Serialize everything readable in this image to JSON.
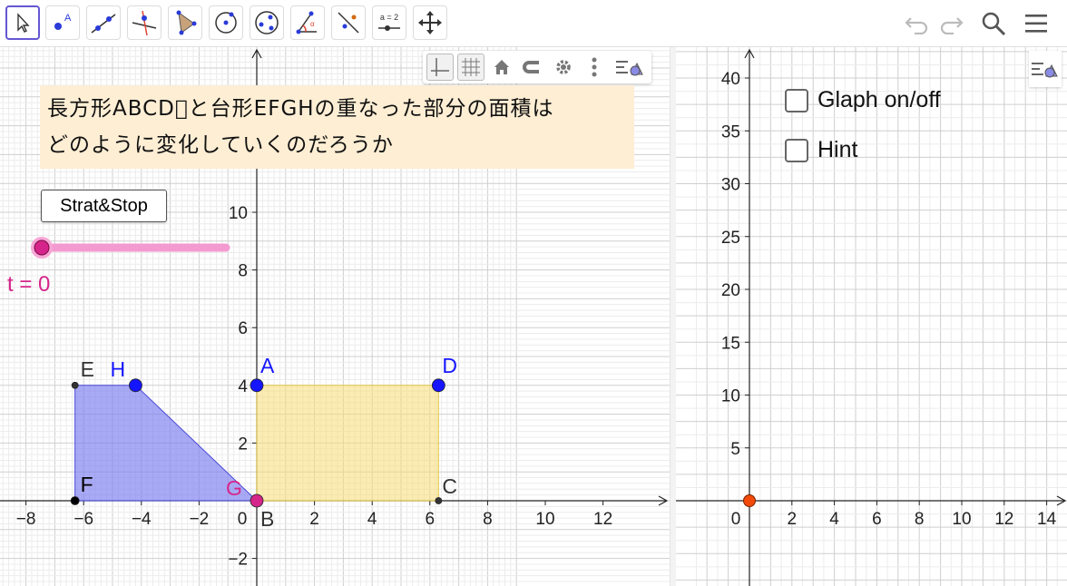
{
  "toolbar": {
    "tools": [
      {
        "name": "move-tool-icon",
        "selected": true
      },
      {
        "name": "point-tool-icon"
      },
      {
        "name": "line-tool-icon"
      },
      {
        "name": "perpendicular-line-tool-icon"
      },
      {
        "name": "polygon-tool-icon"
      },
      {
        "name": "circle-tool-icon"
      },
      {
        "name": "ellipse-tool-icon"
      },
      {
        "name": "angle-tool-icon"
      },
      {
        "name": "reflect-tool-icon"
      },
      {
        "name": "slider-tool-icon",
        "label": "a = 2"
      },
      {
        "name": "move-graphics-view-tool-icon"
      }
    ],
    "right": [
      "undo-icon",
      "redo-icon",
      "search-icon",
      "menu-icon"
    ]
  },
  "graphics1": {
    "title_line1": "長方形ABCD􏰀と台形EFGHの重なった部分の面積は",
    "title_line2": "どのように変化していくのだろうか",
    "start_stop_label": "Strat&Stop",
    "slider_label": "t = 0",
    "slider_value": 0,
    "x_ticks": [
      "−8",
      "−6",
      "−4",
      "−2",
      "0",
      "2",
      "4",
      "6",
      "8",
      "10",
      "12"
    ],
    "y_ticks": [
      "−2",
      "2",
      "4",
      "6",
      "8",
      "10"
    ],
    "rectangle": {
      "A": [
        0,
        4
      ],
      "B": [
        0,
        0
      ],
      "C": [
        6.3,
        0
      ],
      "D": [
        6.3,
        4
      ]
    },
    "trapezoid": {
      "E": [
        -6.3,
        4
      ],
      "F": [
        -6.3,
        0
      ],
      "G": [
        0,
        0
      ],
      "H": [
        -4.2,
        4
      ]
    },
    "point_labels": {
      "A": "A",
      "B": "B",
      "C": "C",
      "D": "D",
      "E": "E",
      "F": "F",
      "G": "G",
      "H": "H"
    },
    "colors": {
      "rect_fill": "#f5dd72",
      "trap_fill": "#7b7cf0",
      "blue_point": "#1515ff",
      "slider": "#d6258a",
      "grid": "#d9d9d9"
    }
  },
  "graphics2": {
    "checkbox_graph": "Glaph on/off",
    "checkbox_hint": "Hint",
    "x_ticks": [
      "2",
      "4",
      "6",
      "8",
      "10",
      "12",
      "14"
    ],
    "y_ticks": [
      "5",
      "10",
      "15",
      "20",
      "25",
      "30",
      "35",
      "40"
    ],
    "origin_label": "0",
    "point_color": "#f24a0a"
  }
}
